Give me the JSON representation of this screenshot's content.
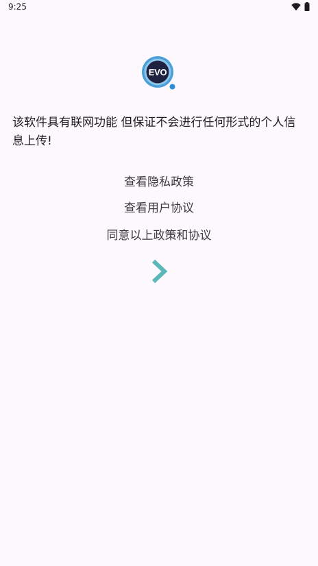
{
  "status_bar": {
    "time": "9:25",
    "icons": [
      "wifi-icon",
      "battery-icon"
    ]
  },
  "logo": {
    "text": "EVO",
    "ring_color": "#4a9fd8",
    "inner_color": "#1f2140",
    "dot_color": "#2f8fd6"
  },
  "notice": {
    "text": "该软件具有联网功能 但保证不会进行任何形式的个人信息上传!"
  },
  "links": {
    "privacy_policy": "查看隐私政策",
    "user_agreement": "查看用户协议",
    "agree": "同意以上政策和协议"
  },
  "next_button": {
    "icon": "chevron-right-icon",
    "color": "#5cb8b8"
  }
}
